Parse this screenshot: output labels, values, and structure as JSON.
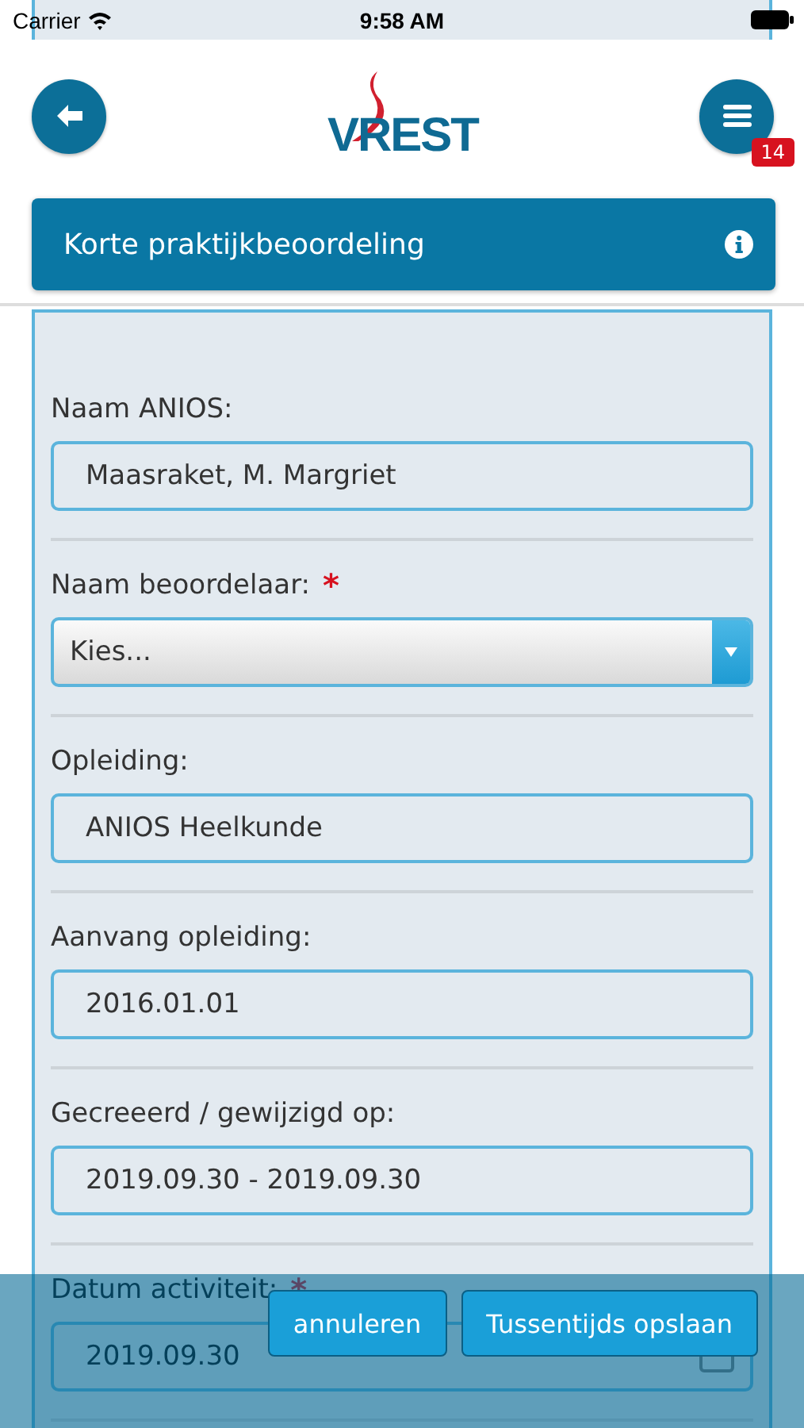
{
  "status_bar": {
    "carrier": "Carrier",
    "time": "9:58 AM"
  },
  "header": {
    "logo": "VREST",
    "notification_count": "14"
  },
  "title_bar": {
    "title": "Korte praktijkbeoordeling"
  },
  "form": {
    "fields": [
      {
        "label": "Naam ANIOS:",
        "kind": "text",
        "value": "Maasraket, M. Margriet"
      },
      {
        "label": "Naam beoordelaar:",
        "kind": "select",
        "required_mark": "*",
        "value": "Kies..."
      },
      {
        "label": "Opleiding:",
        "kind": "text",
        "value": "ANIOS Heelkunde"
      },
      {
        "label": "Aanvang opleiding:",
        "kind": "text",
        "value": "2016.01.01"
      },
      {
        "label": "Gecreeerd / gewijzigd op:",
        "kind": "text",
        "value": "2019.09.30 - 2019.09.30"
      },
      {
        "label": "Datum activiteit:",
        "kind": "date",
        "required_mark": "*",
        "value": "2019.09.30"
      }
    ]
  },
  "bottom_bar": {
    "buttons": [
      "annuleren",
      "Tussentijds opslaan"
    ]
  }
}
